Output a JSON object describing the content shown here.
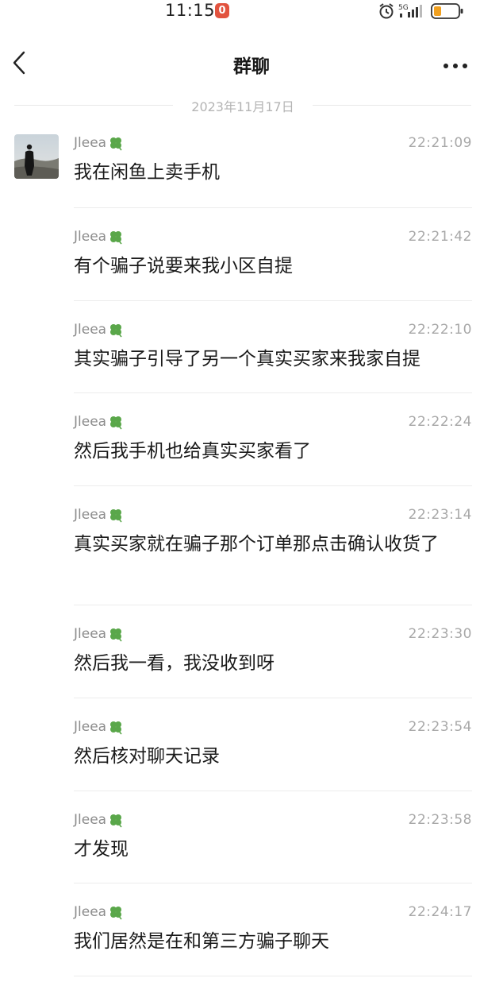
{
  "status_bar": {
    "time": "11:15",
    "notification_count": "0",
    "network": "5G"
  },
  "header": {
    "title": "群聊"
  },
  "date_divider": "2023年11月17日",
  "messages": [
    {
      "sender": "Jleea",
      "time": "22:21:09",
      "text": "我在闲鱼上卖手机"
    },
    {
      "sender": "Jleea",
      "time": "22:21:42",
      "text": "有个骗子说要来我小区自提"
    },
    {
      "sender": "Jleea",
      "time": "22:22:10",
      "text": "其实骗子引导了另一个真实买家来我家自提"
    },
    {
      "sender": "Jleea",
      "time": "22:22:24",
      "text": "然后我手机也给真实买家看了"
    },
    {
      "sender": "Jleea",
      "time": "22:23:14",
      "text": "真实买家就在骗子那个订单那点击确认收货了"
    },
    {
      "sender": "Jleea",
      "time": "22:23:30",
      "text": "然后我一看，我没收到呀"
    },
    {
      "sender": "Jleea",
      "time": "22:23:54",
      "text": "然后核对聊天记录"
    },
    {
      "sender": "Jleea",
      "time": "22:23:58",
      "text": "才发现"
    },
    {
      "sender": "Jleea",
      "time": "22:24:17",
      "text": "我们居然是在和第三方骗子聊天"
    }
  ],
  "colors": {
    "badge": "#e2533f",
    "battery": "#f0a020",
    "clover": "#5aa74a"
  }
}
